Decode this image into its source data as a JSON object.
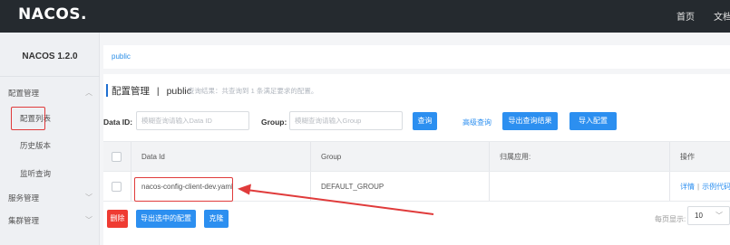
{
  "header": {
    "logo": "NACOS.",
    "nav": [
      "首页",
      "文档"
    ]
  },
  "sidebar": {
    "version": "NACOS 1.2.0",
    "items": [
      {
        "label": "配置管理",
        "type": "group",
        "expanded": true
      },
      {
        "label": "配置列表",
        "type": "sub",
        "selected": true
      },
      {
        "label": "历史版本",
        "type": "sub"
      },
      {
        "label": "监听查询",
        "type": "sub"
      },
      {
        "label": "服务管理",
        "type": "group",
        "expanded": false
      },
      {
        "label": "集群管理",
        "type": "group",
        "expanded": false
      }
    ]
  },
  "namespace": {
    "current": "public"
  },
  "main": {
    "title": "配置管理",
    "title_sep": "|",
    "title_namespace": "public",
    "hint": "查询结果：共查询到 1 条满足要求的配置。",
    "filters": {
      "data_id_label": "Data ID:",
      "data_id_placeholder": "模糊查询请输入Data ID",
      "data_id_value": "",
      "group_label": "Group:",
      "group_placeholder": "模糊查询请输入Group",
      "group_value": ""
    },
    "buttons": {
      "query": "查询",
      "advanced_query": "高级查询",
      "export_results": "导出查询结果",
      "import_config": "导入配置",
      "delete": "删除",
      "export_selected": "导出选中的配置",
      "clone": "克隆"
    },
    "table": {
      "columns": [
        "Data Id",
        "Group",
        "归属应用:",
        "操作"
      ],
      "rows": [
        {
          "data_id": "nacos-config-client-dev.yaml",
          "group": "DEFAULT_GROUP",
          "app": "",
          "actions": [
            "详情",
            "示例代码"
          ]
        }
      ]
    },
    "pagination": {
      "page_size_label": "每页显示:",
      "page_size": "10"
    }
  },
  "colors": {
    "topbar": "#252a2f",
    "primary": "#2c8ff0",
    "danger": "#ef3b32",
    "annotation": "#e03b3b"
  },
  "icons": [
    "chevron-up-icon",
    "chevron-down-icon",
    "checkbox-icon",
    "annotation-arrow"
  ]
}
